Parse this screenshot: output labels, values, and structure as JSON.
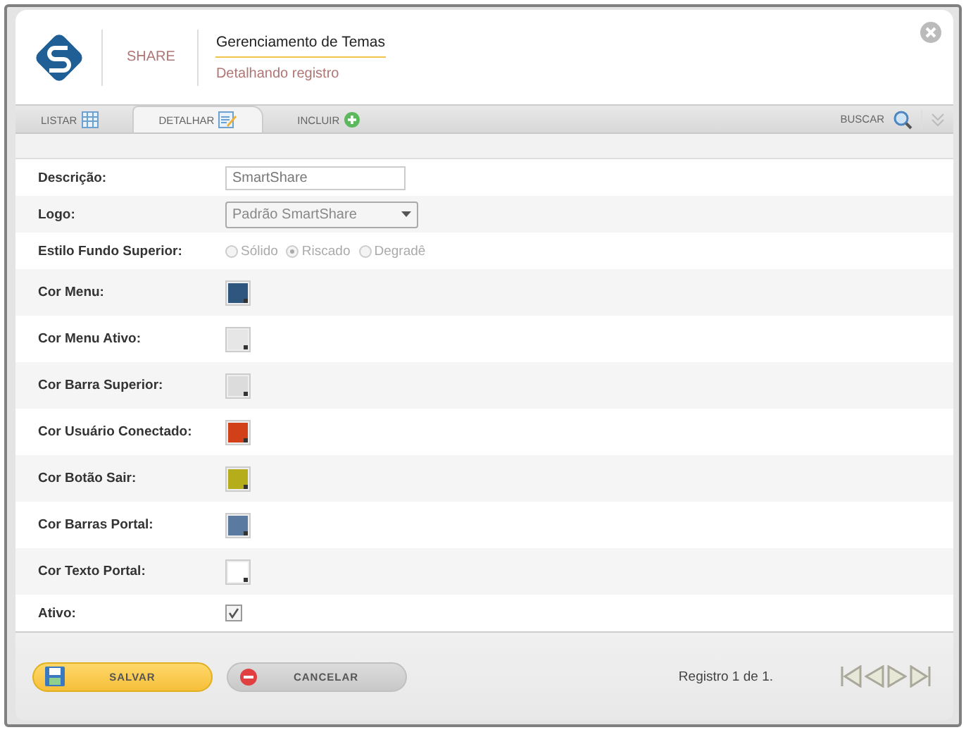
{
  "header": {
    "brand": "SHARE",
    "title": "Gerenciamento de Temas",
    "subtitle": "Detalhando registro"
  },
  "tabs": [
    {
      "label": "LISTAR",
      "kind": "list",
      "selected": false
    },
    {
      "label": "DETALHAR",
      "kind": "detail",
      "selected": true
    },
    {
      "label": "INCLUIR",
      "kind": "add",
      "selected": false
    }
  ],
  "search": {
    "label": "BUSCAR"
  },
  "form": [
    {
      "kind": "text",
      "label": "Descrição:",
      "value": "SmartShare"
    },
    {
      "kind": "select",
      "label": "Logo:",
      "value": "Padrão SmartShare"
    },
    {
      "kind": "radio",
      "label": "Estilo Fundo Superior:",
      "options": [
        {
          "label": "Sólido",
          "selected": false
        },
        {
          "label": "Riscado",
          "selected": true
        },
        {
          "label": "Degradê",
          "selected": false
        }
      ]
    },
    {
      "kind": "color",
      "label": "Cor Menu:",
      "color": "#2f567f"
    },
    {
      "kind": "color",
      "label": "Cor Menu Ativo:",
      "color": "#e6e6e6"
    },
    {
      "kind": "color",
      "label": "Cor Barra Superior:",
      "color": "#dcdcdc"
    },
    {
      "kind": "color",
      "label": "Cor Usuário Conectado:",
      "color": "#d2401a"
    },
    {
      "kind": "color",
      "label": "Cor Botão Sair:",
      "color": "#b5ad1a"
    },
    {
      "kind": "color",
      "label": "Cor Barras Portal:",
      "color": "#5a7aa0"
    },
    {
      "kind": "color",
      "label": "Cor Texto Portal:",
      "color": "#ffffff"
    },
    {
      "kind": "checkbox",
      "label": "Ativo:",
      "checked": true
    }
  ],
  "buttons": [
    {
      "kind": "save",
      "label": "SALVAR"
    },
    {
      "kind": "cancel",
      "label": "CANCELAR"
    }
  ],
  "status": "Registro 1 de 1."
}
